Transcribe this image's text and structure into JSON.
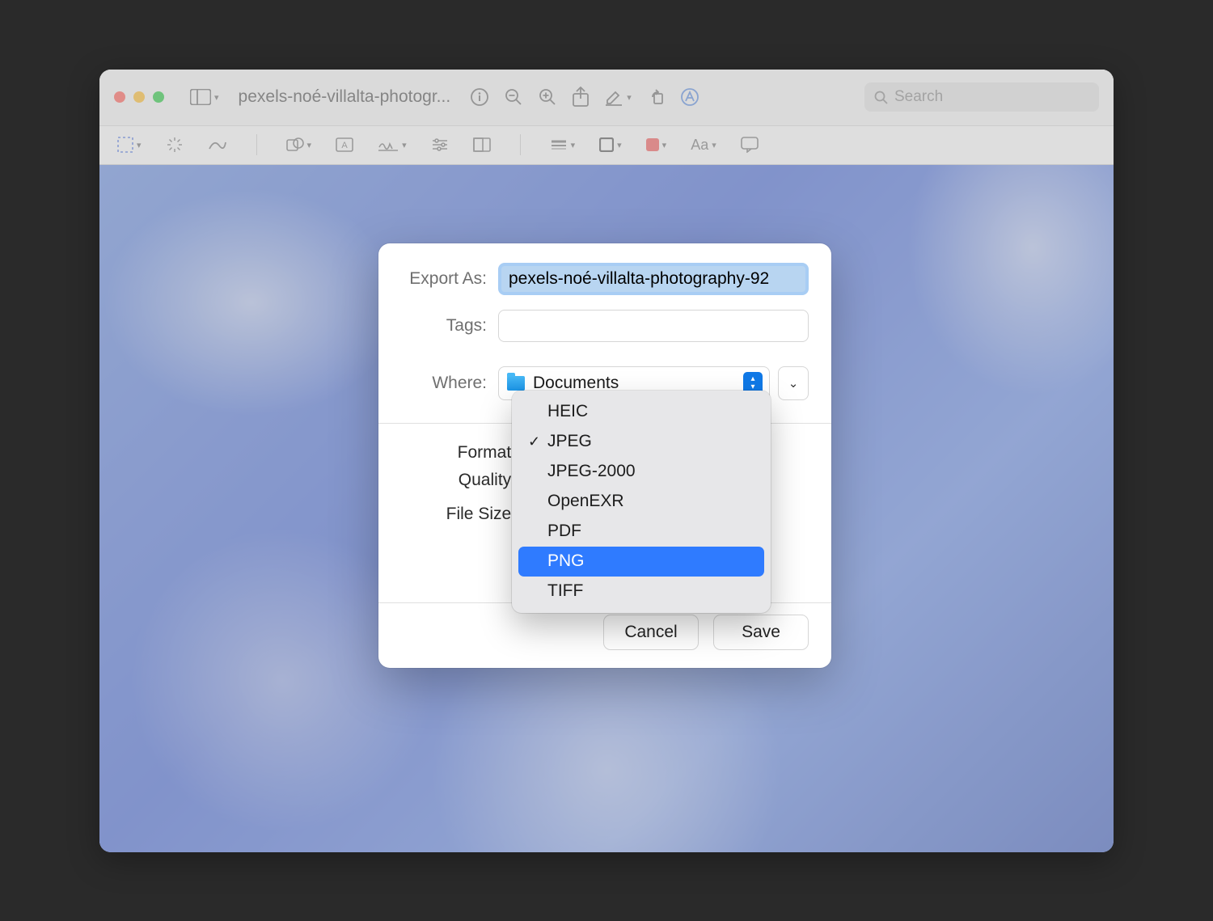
{
  "window": {
    "title": "pexels-noé-villalta-photogr...",
    "search_placeholder": "Search"
  },
  "sheet": {
    "export_as_label": "Export As:",
    "export_as_value": "pexels-noé-villalta-photography-92",
    "tags_label": "Tags:",
    "tags_value": "",
    "where_label": "Where:",
    "where_value": "Documents",
    "format_label": "Format:",
    "quality_label": "Quality:",
    "file_size_label": "File Size:",
    "cancel": "Cancel",
    "save": "Save"
  },
  "format_menu": {
    "items": [
      {
        "label": "HEIC",
        "checked": false,
        "highlight": false
      },
      {
        "label": "JPEG",
        "checked": true,
        "highlight": false
      },
      {
        "label": "JPEG-2000",
        "checked": false,
        "highlight": false
      },
      {
        "label": "OpenEXR",
        "checked": false,
        "highlight": false
      },
      {
        "label": "PDF",
        "checked": false,
        "highlight": false
      },
      {
        "label": "PNG",
        "checked": false,
        "highlight": true
      },
      {
        "label": "TIFF",
        "checked": false,
        "highlight": false
      }
    ]
  }
}
